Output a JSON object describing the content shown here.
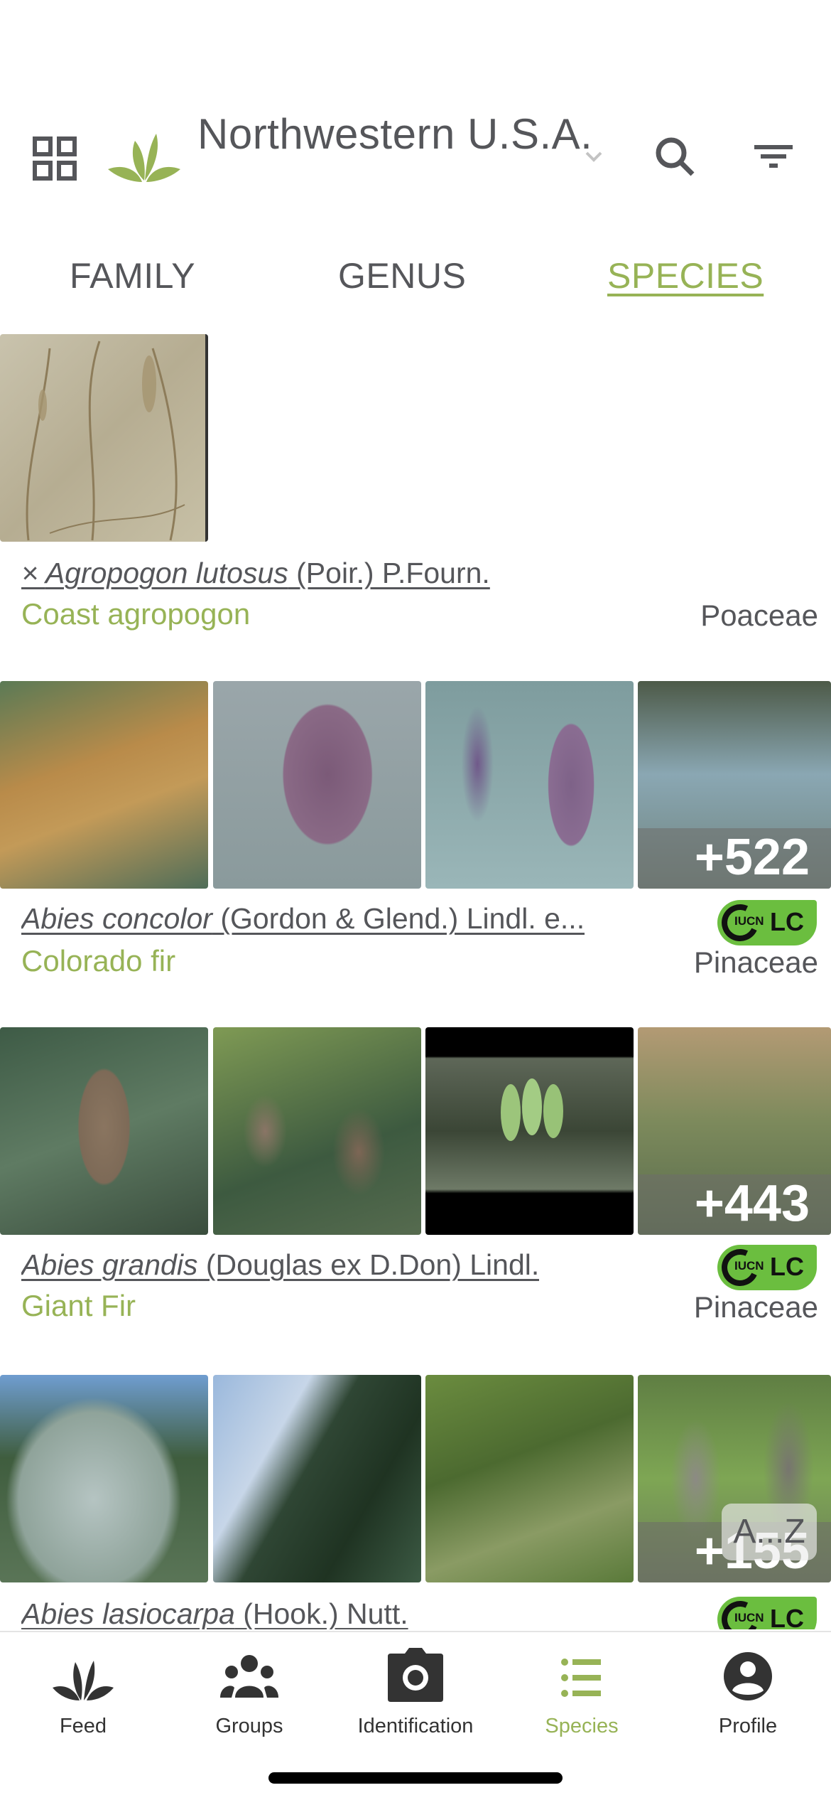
{
  "header": {
    "region_title": "Northwestern U.S.A.",
    "icons": {
      "grid": "grid-icon",
      "logo": "plant-logo-icon",
      "dropdown": "chevron-down-icon",
      "search": "search-icon",
      "filter": "filter-icon"
    }
  },
  "tabs": [
    {
      "label": "FAMILY",
      "active": false
    },
    {
      "label": "GENUS",
      "active": false
    },
    {
      "label": "SPECIES",
      "active": true
    }
  ],
  "colors": {
    "accent": "#97b356",
    "text": "#55565a",
    "iucn_lc": "#6bbe3f",
    "photo_overlay": "#6e6e69"
  },
  "species": [
    {
      "hybrid_mark": "× ",
      "scientific": "Agropogon lutosus",
      "author": " (Poir.) P.Fourn.",
      "common": "Coast agropogon",
      "family": "Poaceae",
      "iucn": null,
      "more_count": null,
      "photo_count_shown": 1
    },
    {
      "hybrid_mark": "",
      "scientific": "Abies concolor",
      "author": " (Gordon & Glend.) Lindl. e...",
      "common": "Colorado fir",
      "family": "Pinaceae",
      "iucn": {
        "org": "IUCN",
        "status": "LC"
      },
      "more_count": "+522",
      "photo_count_shown": 4
    },
    {
      "hybrid_mark": "",
      "scientific": "Abies grandis",
      "author": " (Douglas ex D.Don) Lindl.",
      "common": "Giant Fir",
      "family": "Pinaceae",
      "iucn": {
        "org": "IUCN",
        "status": "LC"
      },
      "more_count": "+443",
      "photo_count_shown": 4
    },
    {
      "hybrid_mark": "",
      "scientific": "Abies lasiocarpa",
      "author": " (Hook.) Nutt.",
      "common": "",
      "family": "",
      "iucn": {
        "org": "IUCN",
        "status": "LC"
      },
      "more_count": "+155",
      "photo_count_shown": 4
    }
  ],
  "az_index": "A...Z",
  "bottom_nav": [
    {
      "label": "Feed",
      "icon": "feed-plant-icon",
      "active": false
    },
    {
      "label": "Groups",
      "icon": "groups-icon",
      "active": false
    },
    {
      "label": "Identification",
      "icon": "camera-icon",
      "active": false
    },
    {
      "label": "Species",
      "icon": "list-icon",
      "active": true
    },
    {
      "label": "Profile",
      "icon": "profile-icon",
      "active": false
    }
  ]
}
